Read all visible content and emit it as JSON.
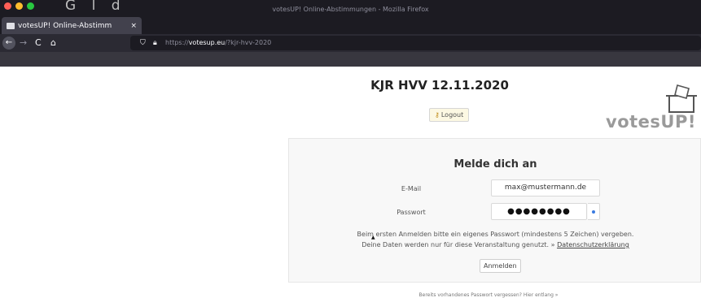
{
  "window": {
    "title": "votesUP! Online-Abstimmungen - Mozilla Firefox",
    "overlay_text": "G    l       d"
  },
  "tab": {
    "label": "votesUP! Online-Abstimm",
    "close": "×",
    "new_tab": "+"
  },
  "nav": {
    "back": "←",
    "forward": "→",
    "reload": "C",
    "home": "⌂"
  },
  "url": {
    "scheme": "https://",
    "host": "votesup.eu",
    "path": "/?kjr-hvv-2020"
  },
  "page": {
    "title": "KJR HVV 12.11.2020",
    "logout_label": "Logout",
    "logout_icon": "key-icon",
    "logo_text": "votesUP!"
  },
  "login": {
    "heading": "Melde dich an",
    "email_label": "E-Mail",
    "email_value": "max@mustermann.de",
    "password_label": "Passwort",
    "password_value": "●●●●●●●●",
    "info_line1": "Beim ersten Anmelden bitte ein eigenes Passwort (mindestens 5 Zeichen) vergeben.",
    "info_line2_prefix": "Deine Daten werden nur für diese Veranstaltung genutzt. » ",
    "privacy_link": "Datenschutzerklärung",
    "submit_label": "Anmelden"
  },
  "footer": {
    "forgot_text": "Bereits vorhandenes Passwort vergessen? Hier entlang »"
  }
}
